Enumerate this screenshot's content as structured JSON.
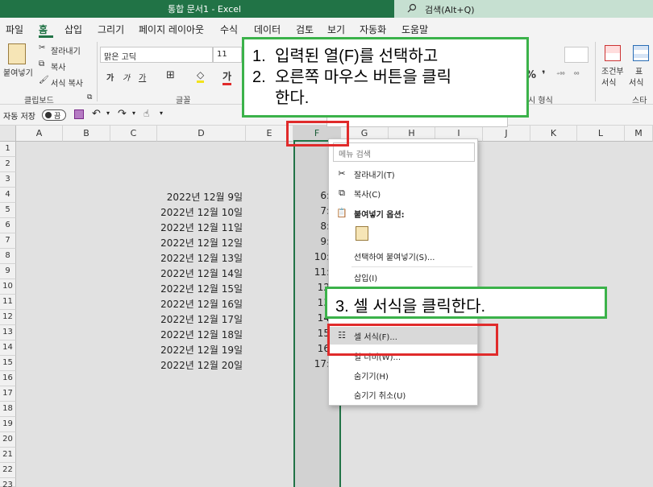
{
  "window": {
    "title": "통합 문서1  -  Excel",
    "search_placeholder": "검색(Alt+Q)"
  },
  "tabs": [
    "파일",
    "홈",
    "삽입",
    "그리기",
    "페이지 레이아웃",
    "수식",
    "데이터",
    "검토",
    "보기",
    "자동화",
    "도움말"
  ],
  "ribbon": {
    "paste": "붙여넣기",
    "cut": "잘라내기",
    "copy": "복사",
    "format_painter": "서식 복사",
    "clipboard_label": "클립보드",
    "font_name": "맑은 고딕",
    "font_size": "11",
    "font_label": "글꼴",
    "number_label": "시 형식",
    "style_label": "스타일",
    "conditional": "조건부",
    "conditional2": "서식",
    "table_format": "표",
    "table_format2": "서식"
  },
  "qat": {
    "autosave": "자동 저장",
    "toggle": "끔"
  },
  "columns": [
    "A",
    "B",
    "C",
    "D",
    "E",
    "F",
    "G",
    "H",
    "I",
    "J",
    "K",
    "L",
    "M"
  ],
  "rows": [
    "1",
    "2",
    "3",
    "4",
    "5",
    "6",
    "7",
    "8",
    "9",
    "10",
    "11",
    "12",
    "13",
    "14",
    "15",
    "16",
    "17",
    "18",
    "19",
    "20",
    "21",
    "22",
    "23"
  ],
  "cells_d": [
    "2022년 12월 9일",
    "2022년 12월 10일",
    "2022년 12월 11일",
    "2022년 12월 12일",
    "2022년 12월 13일",
    "2022년 12월 14일",
    "2022년 12월 15일",
    "2022년 12월 16일",
    "2022년 12월 17일",
    "2022년 12월 18일",
    "2022년 12월 19일",
    "2022년 12월 20일"
  ],
  "cells_f": [
    "6:",
    "7:",
    "8:",
    "9:",
    "10:",
    "11:",
    "12",
    "13",
    "14",
    "15",
    "16",
    "17:"
  ],
  "context_menu": {
    "search": "메뉴 검색",
    "cut": "잘라내기(T)",
    "copy": "복사(C)",
    "paste_options": "붙여넣기 옵션:",
    "paste_special": "선택하여 붙여넣기(S)...",
    "insert": "삽입(I)",
    "format_cells": "셀 서식(F)...",
    "column_width": "열 너비(W)...",
    "hide": "숨기기(H)",
    "unhide": "숨기기 취소(U)"
  },
  "callouts": {
    "step1_num": "1.",
    "step1": "입력된 열(F)를 선택하고",
    "step2_num": "2.",
    "step2_a": "오른쪽 마우스 버튼을 클릭",
    "step2_b": "한다.",
    "step3": "3. 셀 서식을 클릭한다."
  },
  "colors": {
    "excel_green": "#217346",
    "callout_border": "#3bb24a",
    "highlight_red": "#e02b2b"
  }
}
